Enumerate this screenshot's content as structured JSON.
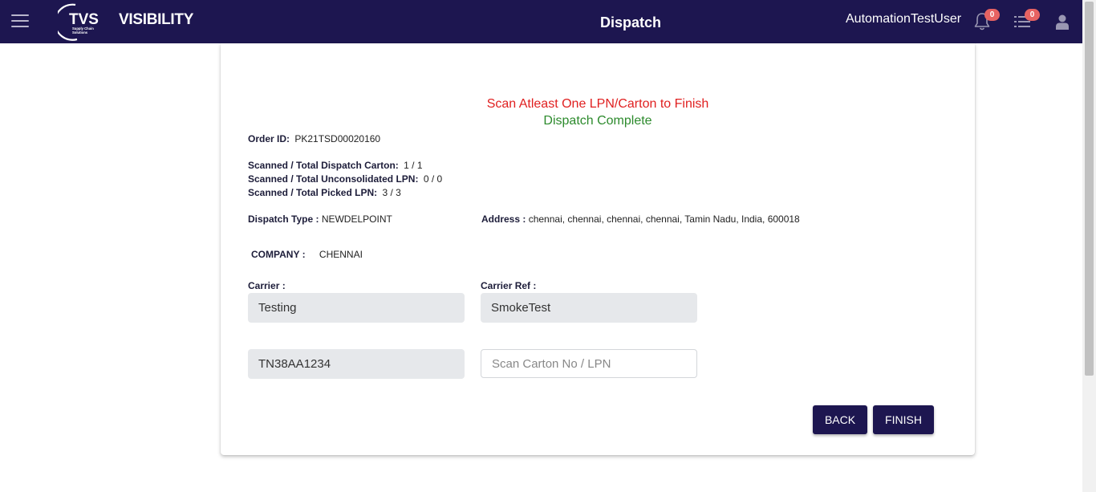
{
  "header": {
    "brand": "VISIBILITY",
    "logo_text": "TVS",
    "logo_subtext": "Supply Chain Solutions",
    "title": "Dispatch",
    "username": "AutomationTestUser",
    "notifications_count": "0",
    "tasks_count": "0",
    "icons": [
      "menu-icon",
      "bell-icon",
      "list-icon",
      "user-icon"
    ],
    "colors": {
      "navbar": "#1d1650",
      "badge": "#e66262"
    }
  },
  "messages": {
    "error": "Scan Atleast One LPN/Carton to Finish",
    "success": "Dispatch Complete",
    "colors": {
      "error": "#e02020",
      "success": "#2c8a2c"
    }
  },
  "order": {
    "order_id_label": "Order ID:",
    "order_id": "PK21TSD00020160",
    "carton_label": "Scanned / Total Dispatch Carton:",
    "carton_value": "1 / 1",
    "unconsolidated_label": "Scanned / Total Unconsolidated LPN:",
    "unconsolidated_value": "0 / 0",
    "picked_label": "Scanned / Total Picked LPN:",
    "picked_value": "3 / 3",
    "dispatch_type_label": "Dispatch Type :",
    "dispatch_type": "NEWDELPOINT",
    "address_label": "Address :",
    "address": "chennai, chennai, chennai, chennai, Tamin Nadu, India, 600018",
    "company_label": "COMPANY :",
    "company": "CHENNAI"
  },
  "form": {
    "carrier_label": "Carrier :",
    "carrier_value": "Testing",
    "carrier_ref_label": "Carrier Ref :",
    "carrier_ref_value": "SmokeTest",
    "vehicle_value": "TN38AA1234",
    "scan_placeholder": "Scan Carton No / LPN",
    "scan_value": ""
  },
  "actions": {
    "back_label": "BACK",
    "finish_label": "FINISH"
  }
}
